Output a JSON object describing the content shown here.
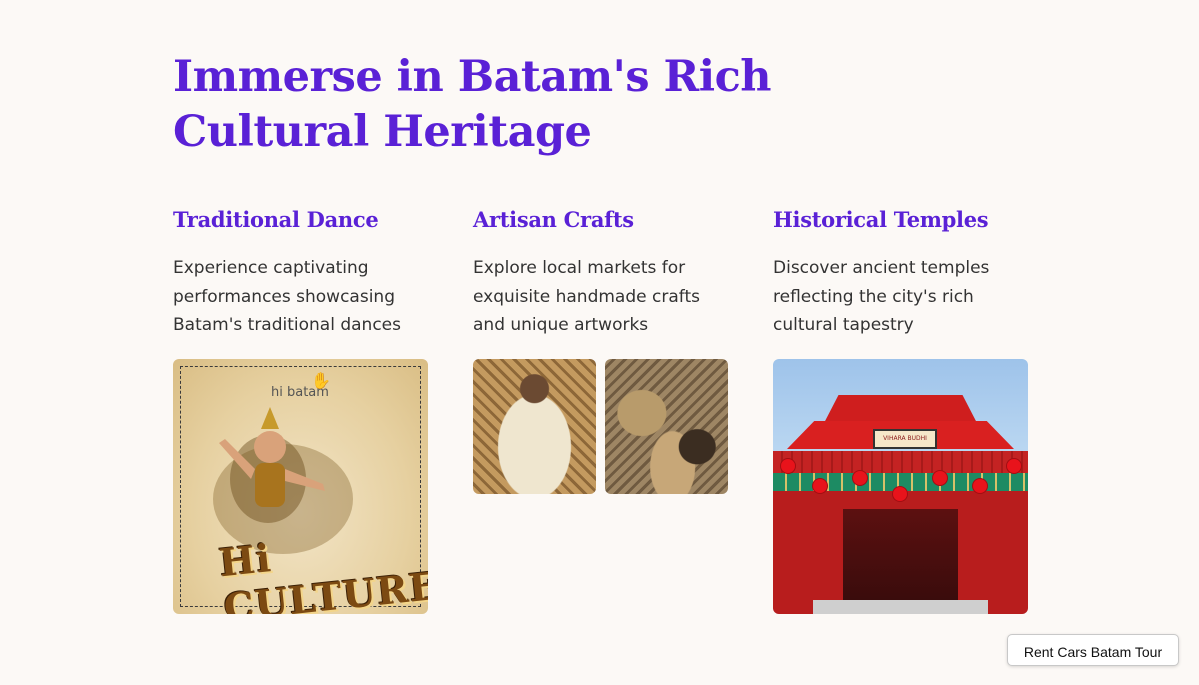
{
  "page": {
    "title": "Immerse in Batam's Rich Cultural Heritage"
  },
  "cards": [
    {
      "title": "Traditional Dance",
      "description": "Experience captivating performances showcasing Batam's traditional dances",
      "image": {
        "brand_text": "hi batam",
        "poster_text": "Hi CULTURE"
      }
    },
    {
      "title": "Artisan Crafts",
      "description": "Explore local markets for exquisite handmade crafts and unique artworks"
    },
    {
      "title": "Historical Temples",
      "description": "Discover ancient temples reflecting the city's rich cultural tapestry",
      "image": {
        "sign_text": "VIHARA BUDHI BHAKTI"
      }
    }
  ],
  "floating_button": {
    "label": "Rent Cars Batam Tour"
  },
  "colors": {
    "accent": "#5a21d6",
    "background": "#fcf9f6",
    "body_text": "#333333"
  }
}
